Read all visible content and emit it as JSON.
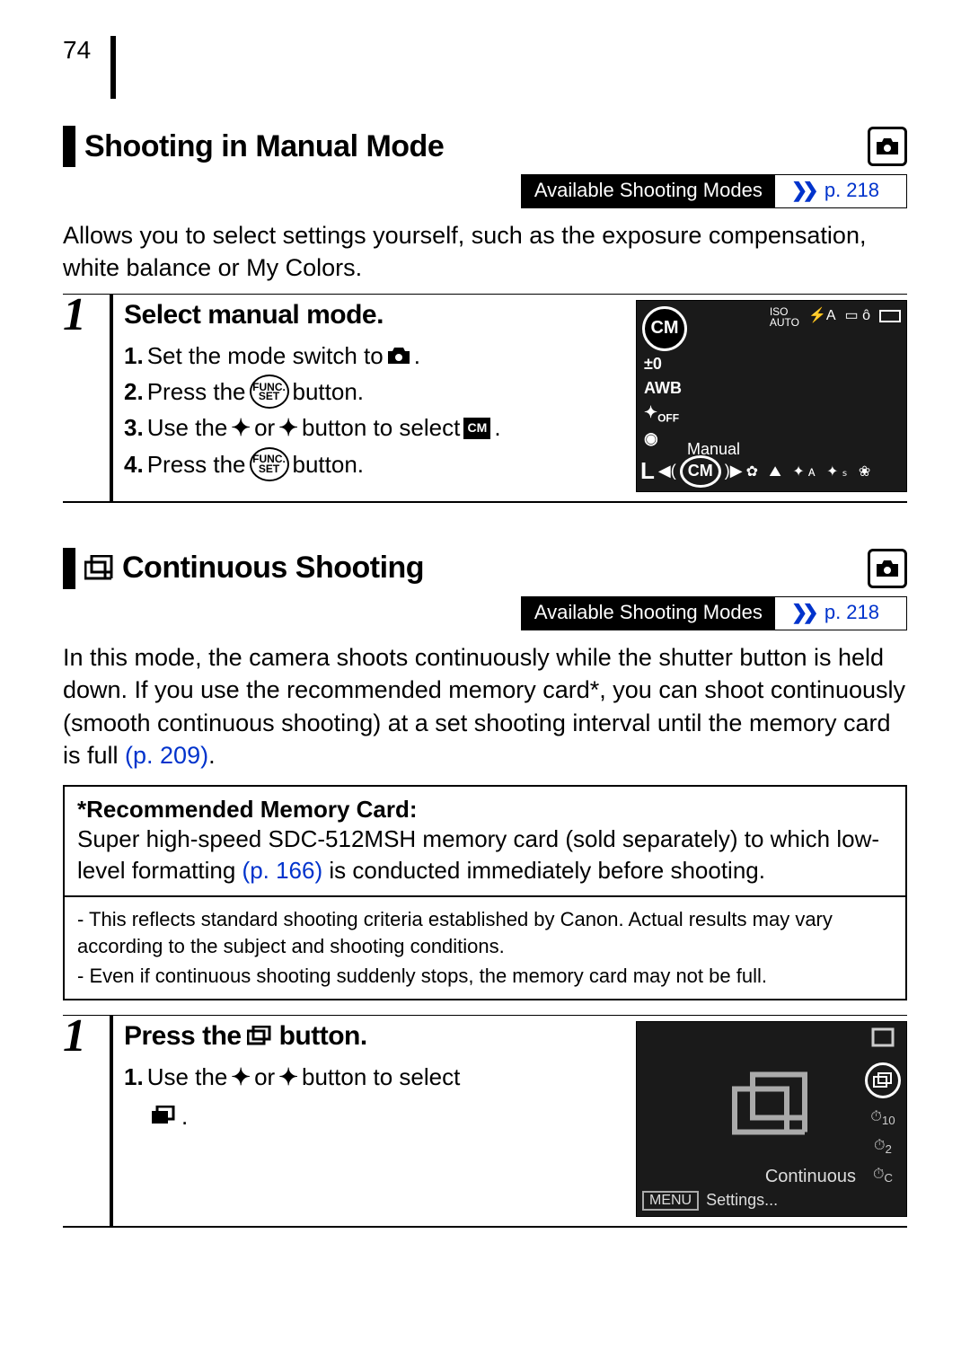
{
  "page_number": "74",
  "section1": {
    "title": "Shooting in Manual Mode",
    "modes_label": "Available Shooting Modes",
    "modes_link": "p. 218",
    "intro": "Allows you to select settings yourself, such as the exposure compensation, white balance or My Colors.",
    "step_number": "1",
    "step_title": "Select manual mode.",
    "s1_num": "1.",
    "s1_a": "Set the mode switch to",
    "s1_b": ".",
    "s2_num": "2.",
    "s2_a": "Press the",
    "s2_b": "button.",
    "s3_num": "3.",
    "s3_a": "Use the",
    "s3_b": "or",
    "s3_c": "button to select",
    "s3_d": ".",
    "s4_num": "4.",
    "s4_a": "Press the",
    "s4_b": "button.",
    "funcset_top": "FUNC.",
    "funcset_bot": "SET",
    "cm_label": "CM",
    "lcd": {
      "cm": "CM",
      "iso": "ISO\nAUTO",
      "flash": "⚡A",
      "pm0": "±0",
      "awb": "AWB",
      "off": "OFF",
      "meter": "◉",
      "manual": "Manual",
      "L": "L"
    }
  },
  "section2": {
    "title": "Continuous Shooting",
    "modes_label": "Available Shooting Modes",
    "modes_link": "p. 218",
    "intro_a": "In this mode, the camera shoots continuously while the shutter button is held down. If you use the recommended memory card*, you can shoot continuously (smooth continuous shooting) at a set shooting interval until the memory card is full ",
    "intro_link": "(p. 209)",
    "intro_b": ".",
    "note_title": "*Recommended Memory Card:",
    "note_body_a": "Super high-speed SDC-512MSH memory card (sold separately) to which low-level formatting ",
    "note_link": "(p. 166)",
    "note_body_b": " is conducted immediately before shooting.",
    "small1": "- This reflects standard shooting criteria established by Canon. Actual results may vary according to the subject and shooting conditions.",
    "small2": "- Even if continuous shooting suddenly stops, the memory card may not be full.",
    "step_number": "1",
    "step_title_a": "Press the",
    "step_title_b": "button.",
    "s1_num": "1.",
    "s1_a": "Use the",
    "s1_b": "or",
    "s1_c": "button to select",
    "s1_d": ".",
    "lcd": {
      "continuous": "Continuous",
      "menu": "MENU",
      "settings": "Settings...",
      "t10": "10",
      "t2": "2",
      "tc": "C"
    }
  }
}
